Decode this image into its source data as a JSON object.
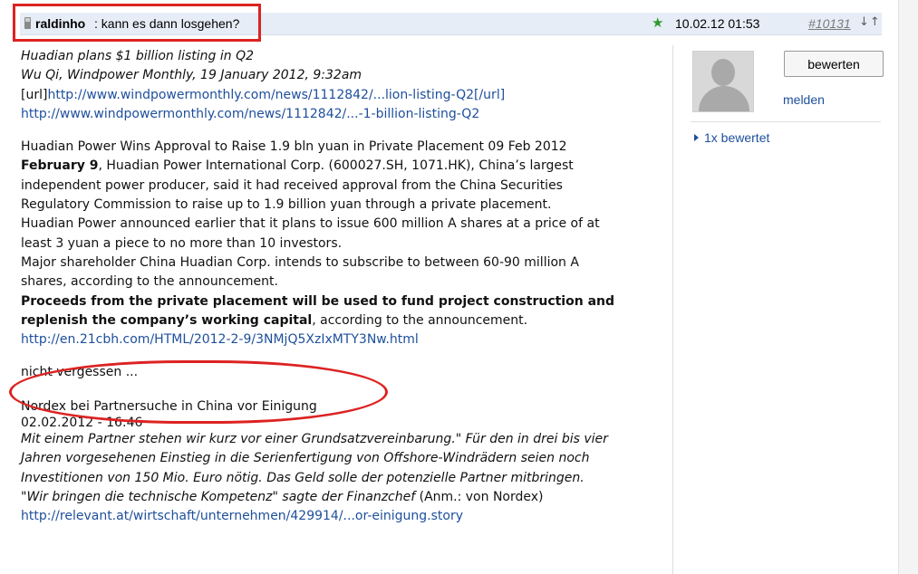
{
  "post": {
    "author": "raldinho",
    "title": ": kann es dann losgehen?",
    "date": "10.02.12 01:53",
    "post_number": "#10131",
    "nav_arrows": "↓↑"
  },
  "body": {
    "line1": "Huadian plans $1 billion listing in Q2",
    "line2": "Wu Qi, Windpower Monthly, 19 January 2012, 9:32am",
    "url_tag_open": "[url]",
    "url_tag_link": "http://www.windpowermonthly.com/news/1112842/...lion-listing-Q2[/url]",
    "link1": "http://www.windpowermonthly.com/news/1112842/...-1-billion-listing-Q2",
    "p2_line1": "Huadian Power Wins Approval to Raise 1.9 bln yuan in Private Placement 09 Feb 2012",
    "p2_date_bold": "February 9",
    "p2_rest1": ", Huadian Power International Corp. (600027.SH, 1071.HK), China’s largest",
    "p2_line3": "independent power producer, said it had received approval from the China Securities",
    "p2_line4": "Regulatory Commission to raise up to 1.9 billion yuan through a private placement.",
    "p2_line5": "Huadian Power announced earlier that it plans to issue 600 million A shares at a price of at",
    "p2_line6": "least 3 yuan a piece to no more than 10 investors.",
    "p2_line7": "Major shareholder China Huadian Corp. intends to subscribe to between 60-90 million A",
    "p2_line8": "shares, according to the announcement.",
    "p2_bold1": "Proceeds from the private placement will be used to fund project construction and",
    "p2_bold2": "replenish the company’s working capital",
    "p2_rest2": ", according to the announcement.",
    "link2": "http://en.21cbh.com/HTML/2012-2-9/3NMjQ5XzIxMTY3Nw.html",
    "p3_line1": "nicht vergessen ...",
    "p3_line2": "Nordex bei Partnersuche in China vor Einigung",
    "p4_date": "02.02.2012 - 16:46",
    "p4_line1": "Mit einem Partner stehen wir kurz vor einer Grundsatzvereinbarung.\" Für den in drei bis vier",
    "p4_line2": "Jahren vorgesehenen Einstieg in die Serienfertigung von Offshore-Windrädern seien noch",
    "p4_line3": "Investitionen von 150 Mio. Euro nötig. Das Geld solle der potenzielle Partner mitbringen.",
    "p4_line4a": "\"Wir bringen die technische Kompetenz\" sagte der Finanzchef",
    "p4_line4b": " (Anm.: von Nordex)",
    "link3": "http://relevant.at/wirtschaft/unternehmen/429914/...or-einigung.story"
  },
  "sidebar": {
    "rate_button": "bewerten",
    "report_link": "melden",
    "rated_text": "1x bewertet"
  }
}
